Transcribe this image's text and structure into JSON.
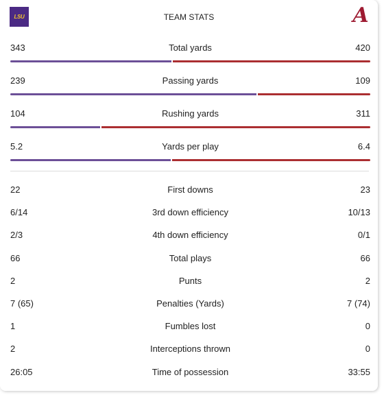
{
  "header": {
    "title": "TEAM STATS",
    "left_team": {
      "logo_text": "LSU",
      "icon": "lsu-logo",
      "color": "#4b2a84"
    },
    "right_team": {
      "logo_text": "A",
      "icon": "alabama-logo",
      "color": "#9e1b32"
    }
  },
  "colors": {
    "left_bar": "#6c4f97",
    "right_bar": "#ab2e31"
  },
  "bar_stats": [
    {
      "label": "Total yards",
      "left": "343",
      "right": "420",
      "left_value": 343,
      "right_value": 420
    },
    {
      "label": "Passing yards",
      "left": "239",
      "right": "109",
      "left_value": 239,
      "right_value": 109
    },
    {
      "label": "Rushing yards",
      "left": "104",
      "right": "311",
      "left_value": 104,
      "right_value": 311
    },
    {
      "label": "Yards per play",
      "left": "5.2",
      "right": "6.4",
      "left_value": 5.2,
      "right_value": 6.4
    }
  ],
  "stats": [
    {
      "label": "First downs",
      "left": "22",
      "right": "23"
    },
    {
      "label": "3rd down efficiency",
      "left": "6/14",
      "right": "10/13"
    },
    {
      "label": "4th down efficiency",
      "left": "2/3",
      "right": "0/1"
    },
    {
      "label": "Total plays",
      "left": "66",
      "right": "66"
    },
    {
      "label": "Punts",
      "left": "2",
      "right": "2"
    },
    {
      "label": "Penalties (Yards)",
      "left": "7 (65)",
      "right": "7 (74)"
    },
    {
      "label": "Fumbles lost",
      "left": "1",
      "right": "0"
    },
    {
      "label": "Interceptions thrown",
      "left": "2",
      "right": "0"
    },
    {
      "label": "Time of possession",
      "left": "26:05",
      "right": "33:55"
    }
  ]
}
